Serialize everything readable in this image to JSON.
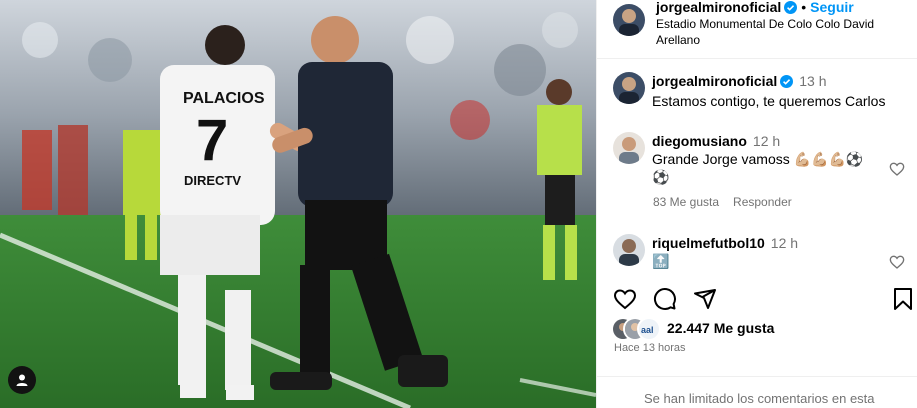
{
  "post": {
    "author": "jorgealmironoficial",
    "follow_label": "Seguir",
    "location": "Estadio Monumental De Colo Colo David Arellano",
    "separator": "•"
  },
  "caption": {
    "username": "jorgealmironoficial",
    "time": "13 h",
    "text": "Estamos contigo, te queremos Carlos"
  },
  "comments": [
    {
      "username": "diegomusiano",
      "time": "12 h",
      "text": "Grande Jorge vamoss 💪🏼💪🏼💪🏼⚽",
      "text2": "⚽",
      "likes": "83 Me gusta",
      "reply_label": "Responder"
    },
    {
      "username": "riquelmefutbol10",
      "time": "12 h",
      "text": "🔝"
    }
  ],
  "stats": {
    "likes": "22.447 Me gusta",
    "ago": "Hace 13 horas"
  },
  "footer": {
    "limited_comments": "Se han limitado los comentarios en esta"
  },
  "colors": {
    "accent": "#0095f6",
    "secondary_text": "#737373",
    "divider": "#efefef"
  },
  "icons": [
    "verified-icon",
    "heart-icon",
    "comment-icon",
    "share-icon",
    "bookmark-icon",
    "user-tag-icon"
  ]
}
